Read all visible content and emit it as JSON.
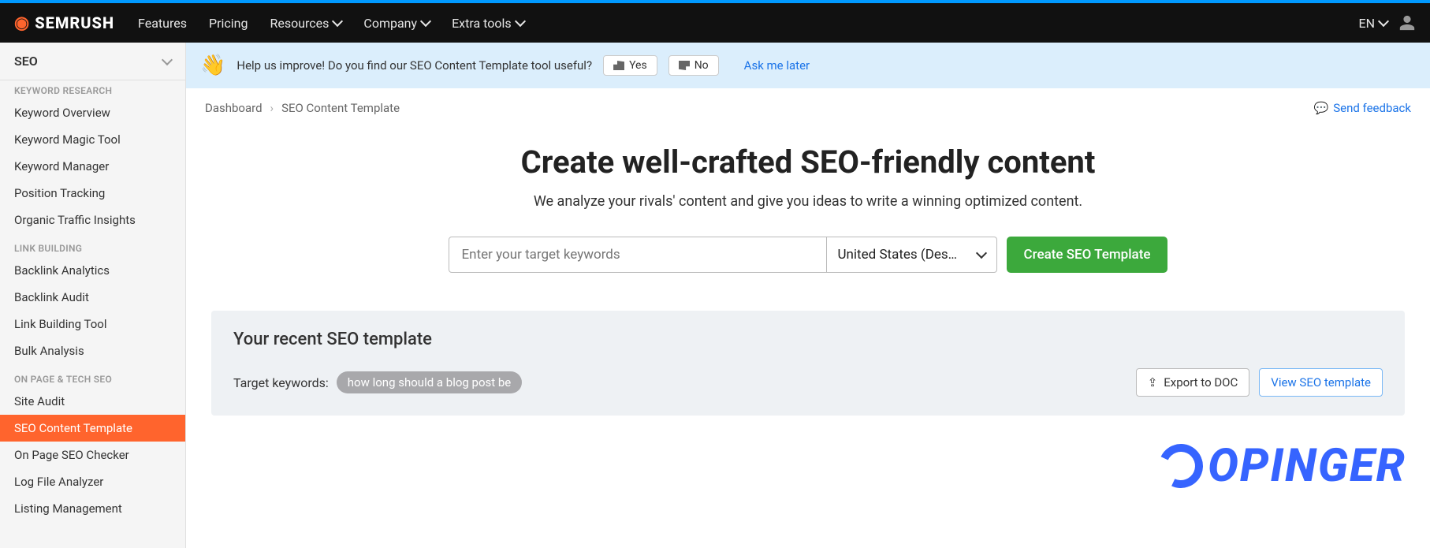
{
  "brand": "SEMRUSH",
  "nav": {
    "features": "Features",
    "pricing": "Pricing",
    "resources": "Resources",
    "company": "Company",
    "extra": "Extra tools",
    "lang": "EN"
  },
  "sidebar": {
    "selector": "SEO",
    "group_keyword": "KEYWORD RESEARCH",
    "kw_overview": "Keyword Overview",
    "kw_magic": "Keyword Magic Tool",
    "kw_manager": "Keyword Manager",
    "kw_position": "Position Tracking",
    "kw_organic": "Organic Traffic Insights",
    "group_link": "LINK BUILDING",
    "lb_analytics": "Backlink Analytics",
    "lb_audit": "Backlink Audit",
    "lb_tool": "Link Building Tool",
    "lb_bulk": "Bulk Analysis",
    "group_onpage": "ON PAGE & TECH SEO",
    "op_audit": "Site Audit",
    "op_template": "SEO Content Template",
    "op_checker": "On Page SEO Checker",
    "op_log": "Log File Analyzer",
    "op_listing": "Listing Management"
  },
  "notice": {
    "text": "Help us improve! Do you find our SEO Content Template tool useful?",
    "yes": "Yes",
    "no": "No",
    "later": "Ask me later"
  },
  "crumbs": {
    "dashboard": "Dashboard",
    "current": "SEO Content Template",
    "feedback": "Send feedback"
  },
  "hero": {
    "title": "Create well-crafted SEO-friendly content",
    "subtitle": "We analyze your rivals' content and give you ideas to write a winning optimized content."
  },
  "form": {
    "placeholder": "Enter your target keywords",
    "region": "United States (Des…",
    "create": "Create SEO Template"
  },
  "recent": {
    "title": "Your recent SEO template",
    "label": "Target keywords:",
    "tag": "how long should a blog post be",
    "export": "Export to DOC",
    "view": "View SEO template"
  },
  "watermark": "OPINGER"
}
